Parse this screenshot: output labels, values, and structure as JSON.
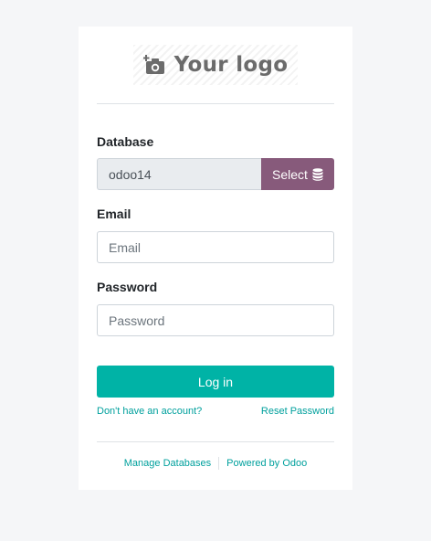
{
  "logo": {
    "text": "Your logo",
    "icon": "camera-plus-icon"
  },
  "database": {
    "label": "Database",
    "value": "odoo14",
    "select_label": "Select",
    "select_icon": "database-icon"
  },
  "email": {
    "label": "Email",
    "placeholder": "Email"
  },
  "password": {
    "label": "Password",
    "placeholder": "Password"
  },
  "login_button": "Log in",
  "links": {
    "signup": "Don't have an account?",
    "reset": "Reset Password"
  },
  "footer": {
    "manage": "Manage Databases",
    "powered": "Powered by Odoo"
  },
  "colors": {
    "primary": "#00b3a6",
    "secondary": "#875a7b",
    "link": "#00a09d"
  }
}
